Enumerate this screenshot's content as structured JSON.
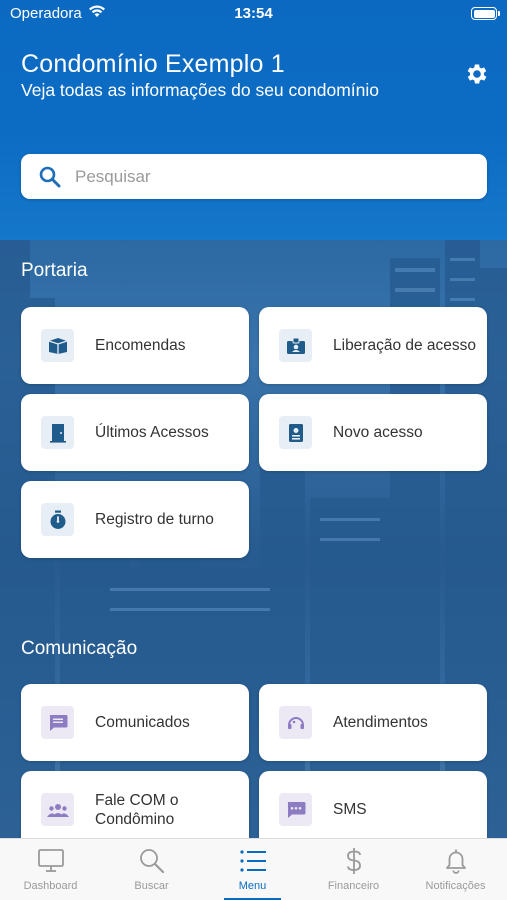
{
  "status_bar": {
    "carrier": "Operadora",
    "time": "13:54"
  },
  "header": {
    "title": "Condomínio Exemplo 1",
    "subtitle": "Veja todas as informações do seu condomínio"
  },
  "search": {
    "placeholder": "Pesquisar",
    "value": ""
  },
  "sections": {
    "portaria": {
      "title": "Portaria",
      "items": [
        {
          "label": "Encomendas",
          "icon": "package-icon"
        },
        {
          "label": "Liberação de acesso",
          "icon": "id-badge-icon"
        },
        {
          "label": "Últimos Acessos",
          "icon": "door-icon"
        },
        {
          "label": "Novo acesso",
          "icon": "contact-card-icon"
        },
        {
          "label": "Registro de turno",
          "icon": "stopwatch-icon"
        }
      ]
    },
    "comunicacao": {
      "title": "Comunicação",
      "items": [
        {
          "label": "Comunicados",
          "icon": "message-icon"
        },
        {
          "label": "Atendimentos",
          "icon": "support-icon"
        },
        {
          "label": "Fale COM o Condômino",
          "icon": "group-icon"
        },
        {
          "label": "SMS",
          "icon": "sms-icon"
        }
      ]
    }
  },
  "tabbar": {
    "items": [
      {
        "label": "Dashboard",
        "icon": "monitor-icon",
        "active": false
      },
      {
        "label": "Buscar",
        "icon": "search-icon",
        "active": false
      },
      {
        "label": "Menu",
        "icon": "list-icon",
        "active": true
      },
      {
        "label": "Financeiro",
        "icon": "dollar-icon",
        "active": false
      },
      {
        "label": "Notificações",
        "icon": "bell-icon",
        "active": false
      }
    ]
  },
  "colors": {
    "primary": "#0a6bc2",
    "header": "#0c6cc4",
    "icon_blue": "#1f5c8b",
    "icon_purple": "#8e7cc3",
    "tab_inactive": "#9a9a9a"
  }
}
